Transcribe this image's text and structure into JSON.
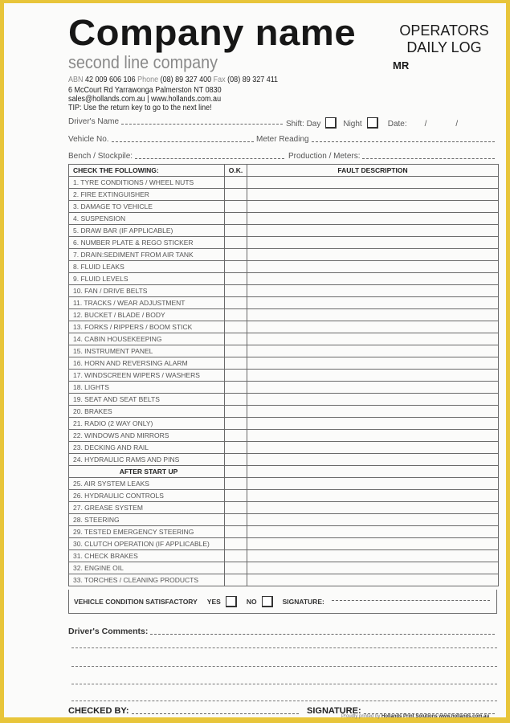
{
  "header": {
    "company_name": "Company name",
    "second_line": "second line company",
    "abn_label": "ABN",
    "abn": "42 009 606 106",
    "phone_label": "Phone",
    "phone": "(08) 89 327 400",
    "fax_label": "Fax",
    "fax": "(08) 89 327 411",
    "address": "6 McCourt Rd Yarrawonga Palmerston NT 0830",
    "contact": "sales@hollands.com.au | www.hollands.com.au",
    "tip": "TIP: Use the return key to go to the next line!",
    "title_line1": "OPERATORS",
    "title_line2": "DAILY LOG",
    "code": "MR"
  },
  "fields": {
    "drivers_name": "Driver's Name",
    "shift": "Shift: Day",
    "night": "Night",
    "date": "Date:",
    "date_sep": "/",
    "vehicle_no": "Vehicle No.",
    "meter_reading": "Meter Reading",
    "bench_stockpile": "Bench / Stockpile:",
    "production_meters": "Production / Meters:"
  },
  "table": {
    "headers": [
      "CHECK THE FOLLOWING:",
      "O.K.",
      "FAULT DESCRIPTION"
    ],
    "items_before": [
      "1. TYRE CONDITIONS  / WHEEL NUTS",
      "2. FIRE EXTINGUISHER",
      "3. DAMAGE TO VEHICLE",
      "4. SUSPENSION",
      "5. DRAW BAR (IF APPLICABLE)",
      "6. NUMBER PLATE & REGO STICKER",
      "7. DRAIN:SEDIMENT FROM AIR TANK",
      "8. FLUID LEAKS",
      "9. FLUID LEVELS",
      "10. FAN / DRIVE BELTS",
      "11. TRACKS  / WEAR ADJUSTMENT",
      "12. BUCKET / BLADE / BODY",
      "13. FORKS / RIPPERS / BOOM STICK",
      "14. CABIN HOUSEKEEPING",
      "15. INSTRUMENT PANEL",
      "16. HORN AND REVERSING ALARM",
      "17. WINDSCREEN WIPERS / WASHERS",
      "18. LIGHTS",
      "19. SEAT AND SEAT BELTS",
      "20. BRAKES",
      "21. RADIO (2 WAY ONLY)",
      "22. WINDOWS AND MIRRORS",
      "23. DECKING AND RAIL",
      "24. HYDRAULIC RAMS AND PINS"
    ],
    "section_label": "AFTER START UP",
    "items_after": [
      "25. AIR SYSTEM LEAKS",
      "26. HYDRAULIC CONTROLS",
      "27. GREASE SYSTEM",
      "28. STEERING",
      "29. TESTED EMERGENCY STEERING",
      "30. CLUTCH OPERATION (IF APPLICABLE)",
      "31. CHECK BRAKES",
      "32. ENGINE OIL",
      "33. TORCHES / CLEANING PRODUCTS"
    ]
  },
  "condition": {
    "label": "VEHICLE CONDITION SATISFACTORY",
    "yes": "YES",
    "no": "NO",
    "signature": "SIGNATURE:"
  },
  "comments": {
    "label": "Driver's Comments:"
  },
  "footer": {
    "checked_by": "CHECKED BY:",
    "signature": "SIGNATURE:",
    "printer_prefix": "Proudly printed by",
    "printer_name": "Hollands Print Solutions",
    "printer_url": "www.hollands.com.au"
  }
}
